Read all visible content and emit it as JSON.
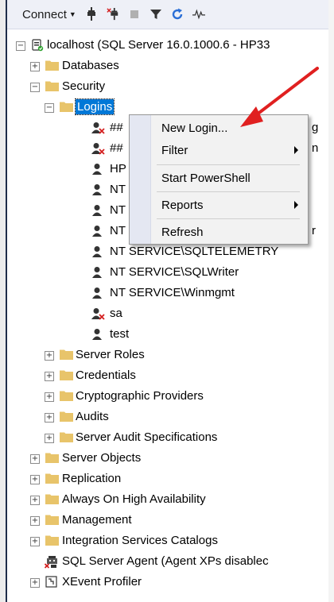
{
  "toolbar": {
    "connect_label": "Connect",
    "icons": [
      "connect-object-explorer-icon",
      "disconnect-icon",
      "stop-icon",
      "filter-icon",
      "refresh-icon",
      "activity-monitor-icon"
    ]
  },
  "tree": {
    "server_label": "localhost (SQL Server 16.0.1000.6 - HP33",
    "databases": "Databases",
    "security": "Security",
    "logins": "Logins",
    "login_items": [
      {
        "label": "##",
        "disabled": true
      },
      {
        "label": "##",
        "disabled": true
      },
      {
        "label": "HP",
        "disabled": false
      },
      {
        "label": "NT",
        "disabled": false
      },
      {
        "label": "NT",
        "disabled": false
      },
      {
        "label": "NT",
        "disabled": false
      },
      {
        "label": "NT SERVICE\\SQLTELEMETRY",
        "disabled": false
      },
      {
        "label": "NT SERVICE\\SQLWriter",
        "disabled": false
      },
      {
        "label": "NT SERVICE\\Winmgmt",
        "disabled": false
      },
      {
        "label": "sa",
        "disabled": true
      },
      {
        "label": "test",
        "disabled": false
      }
    ],
    "clipped_right_chars": [
      "g",
      "n",
      "",
      "",
      "",
      "r"
    ],
    "security_children": [
      "Server Roles",
      "Credentials",
      "Cryptographic Providers",
      "Audits",
      "Server Audit Specifications"
    ],
    "server_children": [
      "Server Objects",
      "Replication",
      "Always On High Availability",
      "Management",
      "Integration Services Catalogs"
    ],
    "agent": "SQL Server Agent (Agent XPs disablec",
    "xevent": "XEvent Profiler"
  },
  "context_menu": {
    "items": [
      {
        "label": "New Login...",
        "submenu": false
      },
      {
        "label": "Filter",
        "submenu": true
      },
      {
        "label": "Start PowerShell",
        "submenu": false
      },
      {
        "label": "Reports",
        "submenu": true
      },
      {
        "label": "Refresh",
        "submenu": false
      }
    ]
  },
  "colors": {
    "selection": "#0078d7",
    "folder": "#e8c46a",
    "annotation_arrow": "#e02020",
    "disabled_x": "#d41e1e"
  }
}
